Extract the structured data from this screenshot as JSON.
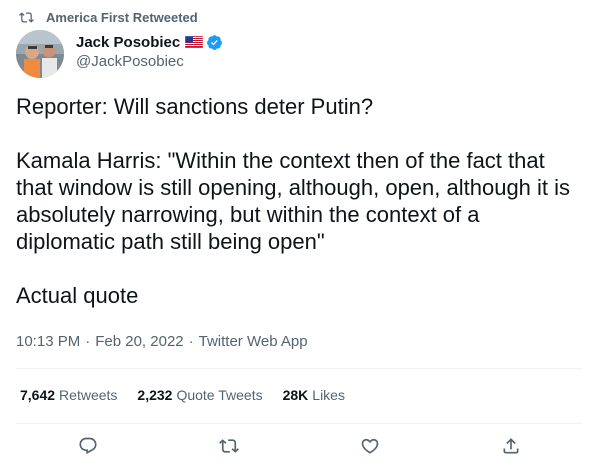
{
  "retweet_context": {
    "text": "America First Retweeted",
    "icon": "retweet-icon"
  },
  "author": {
    "name": "Jack Posobiec",
    "handle": "@JackPosobiec",
    "flag_icon": "us-flag-icon",
    "verified_icon": "verified-badge-icon",
    "avatar_icon": "avatar"
  },
  "tweet": {
    "line1": "Reporter: Will sanctions deter Putin?",
    "line2": "Kamala Harris: \"Within the context then of the fact that that window is still opening, although, open, although it is absolutely narrowing, but within the context of a diplomatic path still being open\"",
    "line3": "Actual quote"
  },
  "meta": {
    "time": "10:13 PM",
    "separator": "·",
    "date": "Feb 20, 2022",
    "source": "Twitter Web App"
  },
  "stats": {
    "retweets_count": "7,642",
    "retweets_label": "Retweets",
    "quotes_count": "2,232",
    "quotes_label": "Quote Tweets",
    "likes_count": "28K",
    "likes_label": "Likes"
  },
  "actions": [
    "reply-icon",
    "retweet-icon",
    "like-icon",
    "share-icon"
  ],
  "colors": {
    "text": "#0f1419",
    "secondary": "#536471",
    "divider": "#eff3f4",
    "verified": "#1d9bf0"
  }
}
